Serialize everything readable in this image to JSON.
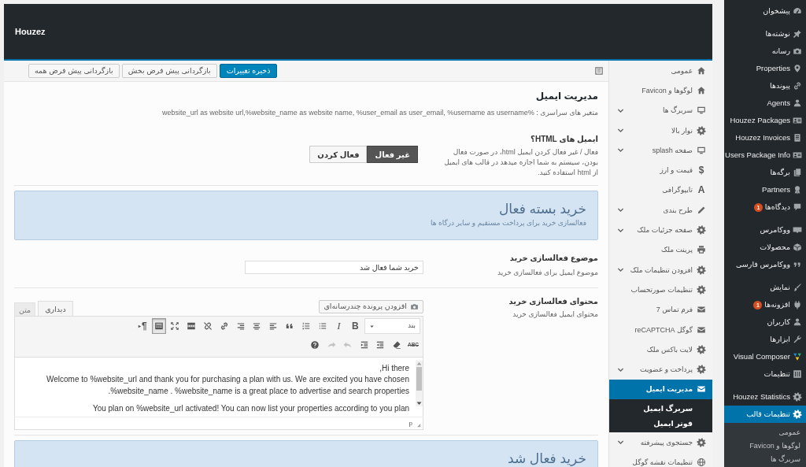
{
  "admin_menu": {
    "groups": [
      [
        {
          "label": "پیشخوان",
          "selected": false
        }
      ],
      [
        {
          "label": "نوشته‌ها",
          "selected": false
        },
        {
          "label": "رسانه",
          "selected": false
        },
        {
          "label": "Properties",
          "selected": false
        },
        {
          "label": "پیوندها",
          "selected": false
        },
        {
          "label": "Agents",
          "selected": false
        },
        {
          "label": "Houzez Packages",
          "selected": false
        },
        {
          "label": "Houzez Invoices",
          "selected": false
        },
        {
          "label": "Users Package Info",
          "selected": false
        },
        {
          "label": "برگه‌ها",
          "selected": false
        },
        {
          "label": "Partners",
          "selected": false
        },
        {
          "label": "دیدگاه‌ها",
          "selected": false,
          "badge": "1"
        }
      ],
      [
        {
          "label": "ووکامرس",
          "selected": false
        },
        {
          "label": "محصولات",
          "selected": false
        },
        {
          "label": "ووکامرس فارسی",
          "selected": false
        }
      ],
      [
        {
          "label": "نمایش",
          "selected": false
        },
        {
          "label": "افزونه‌ها",
          "selected": false,
          "badge": "1"
        },
        {
          "label": "کاربران",
          "selected": false
        },
        {
          "label": "ابزارها",
          "selected": false
        },
        {
          "label": "Visual Composer",
          "selected": false
        },
        {
          "label": "تنظیمات",
          "selected": false
        }
      ],
      [
        {
          "label": "Houzez Statistics",
          "selected": false
        },
        {
          "label": "تنظیمات قالب",
          "selected": true,
          "children": [
            {
              "label": "عمومی",
              "selected": false
            },
            {
              "label": "لوگوها و Favicon",
              "selected": false
            },
            {
              "label": "سربرگ ها",
              "selected": false
            }
          ]
        }
      ]
    ]
  },
  "theme_panel": {
    "title": "Houzez",
    "buttons": [
      {
        "label": "ذخیره تغییرات",
        "kind": "primary"
      },
      {
        "label": "بازگردانی پیش فرض بخش",
        "kind": "secondary"
      },
      {
        "label": "بازگردانی پیش فرض همه",
        "kind": "secondary"
      }
    ],
    "sections": [
      {
        "label": "عمومی",
        "expandable": false,
        "selected": false
      },
      {
        "label": "لوگوها و Favicon",
        "expandable": false,
        "selected": false
      },
      {
        "label": "سربرگ ها",
        "expandable": true,
        "selected": false
      },
      {
        "label": "نوار بالا",
        "expandable": true,
        "selected": false
      },
      {
        "label": "صفحه splash",
        "expandable": true,
        "selected": false
      },
      {
        "label": "قیمت و ارز",
        "expandable": false,
        "selected": false,
        "icon_glyph": "$"
      },
      {
        "label": "تایپوگرافی",
        "expandable": false,
        "selected": false,
        "icon_glyph": "A"
      },
      {
        "label": "طرح بندی",
        "expandable": true,
        "selected": false
      },
      {
        "label": "صفحه جزئیات ملک",
        "expandable": true,
        "selected": false
      },
      {
        "label": "پرینت ملک",
        "expandable": false,
        "selected": false
      },
      {
        "label": "افزودن تنظیمات ملک",
        "expandable": true,
        "selected": false
      },
      {
        "label": "تنظیمات صورتحساب",
        "expandable": false,
        "selected": false
      },
      {
        "label": "فرم تماس 7",
        "expandable": false,
        "selected": false
      },
      {
        "label": "گوگل reCAPTCHA",
        "expandable": false,
        "selected": false
      },
      {
        "label": "لایت باکس ملک",
        "expandable": false,
        "selected": false
      },
      {
        "label": "پرداخت و عضویت",
        "expandable": true,
        "selected": false
      },
      {
        "label": "مدیریت ایمیل",
        "expandable": false,
        "selected": true,
        "children": [
          {
            "label": "سربرگ ایمیل",
            "selected": false
          },
          {
            "label": "فوتر ایمیل",
            "selected": false
          }
        ]
      },
      {
        "label": "جستجوی پیشرفته",
        "expandable": true,
        "selected": false
      },
      {
        "label": "تنظیمات نقشه گوگل",
        "expandable": false,
        "selected": false
      }
    ],
    "content": [
      {
        "kind": "heading",
        "title": "مدیریت ایمیل",
        "description": "متغیر های سراسری : %website_url as website url,%website_name as website name, %user_email as user_email, %username as username"
      },
      {
        "kind": "toggle",
        "label": "ایمیل های HTML؟",
        "description": "فعال / غیر فعال کردن ایمیل html، در صورت فعال بودن، سیستم به شما اجازه میدهد در قالب های ایمیل از html استفاده کنید.",
        "options": [
          {
            "label": "غیر فعال",
            "selected": true
          },
          {
            "label": "فعال کردن",
            "selected": false
          }
        ]
      },
      {
        "kind": "info",
        "title": "خرید بسته فعال",
        "description": "فعالسازی خرید برای پرداخت مستقیم و سایر درگاه ها"
      },
      {
        "kind": "text",
        "label": "موضوع فعالسازی خرید",
        "description": "موضوع ایمیل برای فعالسازی خرید",
        "value": "خرید شما فعال شد"
      },
      {
        "kind": "editor",
        "label": "محتوای فعالسازی خرید",
        "description": "محتوای ایمیل فعالسازی خرید",
        "editor": {
          "media_button": "افزودن پرونده چندرسانه‌ای",
          "tabs": [
            {
              "label": "دیداری",
              "selected": true
            },
            {
              "label": "متن",
              "selected": false
            }
          ],
          "toolbar_rows": [
            [
              {
                "kind": "select",
                "label": "بند"
              },
              {
                "kind": "bold",
                "label": "B",
                "pressed": false,
                "disabled": false
              },
              {
                "kind": "italic",
                "label": "I",
                "pressed": false,
                "disabled": false
              },
              {
                "kind": "icon",
                "pressed": false,
                "disabled": false
              },
              {
                "kind": "icon",
                "pressed": false,
                "disabled": false
              },
              {
                "kind": "icon",
                "pressed": false,
                "disabled": false
              },
              {
                "kind": "icon",
                "pressed": false,
                "disabled": false
              },
              {
                "kind": "icon",
                "pressed": false,
                "disabled": false
              },
              {
                "kind": "icon",
                "pressed": false,
                "disabled": false
              },
              {
                "kind": "icon",
                "pressed": false,
                "disabled": false
              },
              {
                "kind": "icon",
                "pressed": false,
                "disabled": false
              },
              {
                "kind": "icon",
                "pressed": false,
                "disabled": false
              },
              {
                "kind": "icon",
                "pressed": false,
                "disabled": false
              },
              {
                "kind": "icon",
                "pressed": true,
                "disabled": false
              },
              {
                "kind": "direction",
                "label": "¶",
                "pressed": false,
                "disabled": false
              }
            ],
            [
              {
                "kind": "strike",
                "label": "ABC",
                "pressed": false,
                "disabled": false
              },
              {
                "kind": "icon",
                "pressed": false,
                "disabled": false
              },
              {
                "kind": "icon",
                "pressed": false,
                "disabled": false
              },
              {
                "kind": "icon",
                "pressed": false,
                "disabled": false
              },
              {
                "kind": "icon",
                "pressed": false,
                "disabled": true
              },
              {
                "kind": "icon",
                "pressed": false,
                "disabled": true
              },
              {
                "kind": "icon",
                "pressed": false,
                "disabled": false
              }
            ]
          ],
          "paragraphs": [
            [
              "Hi there,",
              "Welcome to %website_url and thank you for purchasing a plan with us. We are excited you have chosen %website_name . %website_name is a great place to advertise and search properties."
            ],
            [
              "You plan on %website_url activated! You can now list your properties according to you plan"
            ]
          ],
          "path": "p"
        }
      },
      {
        "kind": "info",
        "title": "خرید فعال شد"
      }
    ]
  }
}
